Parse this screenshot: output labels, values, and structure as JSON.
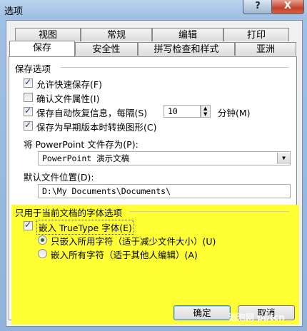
{
  "window": {
    "title": "选项",
    "help_label": "?",
    "close_label": "X"
  },
  "tabs_row1": [
    {
      "label": "视图"
    },
    {
      "label": "常规"
    },
    {
      "label": "编辑"
    },
    {
      "label": "打印"
    }
  ],
  "tabs_row2": [
    {
      "label": "保存",
      "active": true
    },
    {
      "label": "安全性"
    },
    {
      "label": "拼写检查和样式"
    },
    {
      "label": "亚洲"
    }
  ],
  "save_options": {
    "section_title": "保存选项",
    "fast_save": {
      "label": "允许快速保存(F)",
      "checked": true
    },
    "confirm_props": {
      "label": "确认文件属性(I)",
      "checked": false
    },
    "autorecover": {
      "label": "保存自动恢复信息，每隔(S)",
      "checked": true,
      "value": "10",
      "unit": "分钟(M)"
    },
    "save_compat": {
      "label": "保存为早期版本时转换图形(C)",
      "checked": true
    }
  },
  "save_as": {
    "label": "将 PowerPoint 文件存为(P):",
    "value": "PowerPoint 演示文稿",
    "arrow": "▼"
  },
  "default_location": {
    "label": "默认文件位置(D):",
    "value": "D:\\My Documents\\Documents\\"
  },
  "font_options": {
    "section_title": "只用于当前文档的字体选项",
    "embed": {
      "label": "嵌入 TrueType 字体(E)",
      "checked": true
    },
    "only_used": {
      "label": "只嵌入所用字符（适于减少文件大小）(U)",
      "checked": true
    },
    "all_chars": {
      "label": "嵌入所有字符（适于其他人编辑）(A)",
      "checked": false
    }
  },
  "buttons": {
    "ok": "确定",
    "cancel": "取消"
  },
  "watermark": "泡泡网 pptcn"
}
